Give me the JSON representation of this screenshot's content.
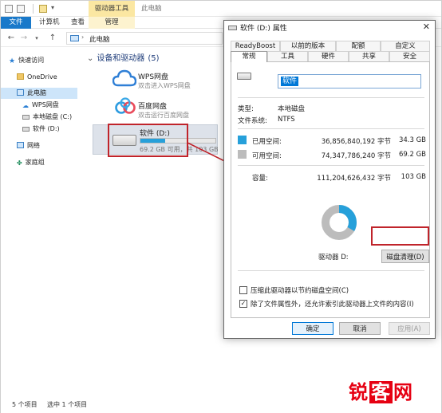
{
  "explorer": {
    "ribbon_context": "驱动器工具",
    "window_title": "此电脑",
    "tabs": {
      "file": "文件",
      "computer": "计算机",
      "view": "查看",
      "manage": "管理"
    },
    "address": "此电脑",
    "sidebar": {
      "quick_access": "快速访问",
      "onedrive": "OneDrive",
      "this_pc": "此电脑",
      "wps": "WPS网盘",
      "local_c": "本地磁盘 (C:)",
      "soft_d": "软件 (D:)",
      "network": "网络",
      "homegroup": "家庭组"
    },
    "section": {
      "title": "设备和驱动器",
      "count": "(5)"
    },
    "drives": {
      "wps": {
        "name": "WPS网盘",
        "desc": "双击进入WPS网盘"
      },
      "baidu": {
        "name": "百度网盘",
        "desc": "双击运行百度网盘"
      },
      "d": {
        "name": "软件 (D:)",
        "info": "69.2 GB 可用，共 103 GB",
        "used_fraction": 0.33
      }
    },
    "status": {
      "count": "5 个项目",
      "selected": "选中 1 个项目"
    }
  },
  "dialog": {
    "title": "软件 (D:) 属性",
    "tabs_row1": [
      "ReadyBoost",
      "以前的版本",
      "配额",
      "自定义"
    ],
    "tabs_row2": [
      "常规",
      "工具",
      "硬件",
      "共享",
      "安全"
    ],
    "volume_name": "软件",
    "type_label": "类型:",
    "type_value": "本地磁盘",
    "fs_label": "文件系统:",
    "fs_value": "NTFS",
    "used_label": "已用空间:",
    "used_bytes": "36,856,840,192 字节",
    "used_gb": "34.3 GB",
    "free_label": "可用空间:",
    "free_bytes": "74,347,786,240 字节",
    "free_gb": "69.2 GB",
    "cap_label": "容量:",
    "cap_bytes": "111,204,626,432 字节",
    "cap_gb": "103 GB",
    "drive_label": "驱动器 D:",
    "cleanup_button": "磁盘清理(D)",
    "compress_label": "压缩此驱动器以节约磁盘空间(C)",
    "index_label": "除了文件属性外，还允许索引此驱动器上文件的内容(I)",
    "ok": "确定",
    "cancel": "取消",
    "apply": "应用(A)",
    "colors": {
      "used": "#26a0da",
      "free": "#bcbcbc"
    },
    "used_fraction": 0.3314
  },
  "watermark": {
    "text_a": "锐",
    "text_b": "客",
    "text_c": "网"
  }
}
